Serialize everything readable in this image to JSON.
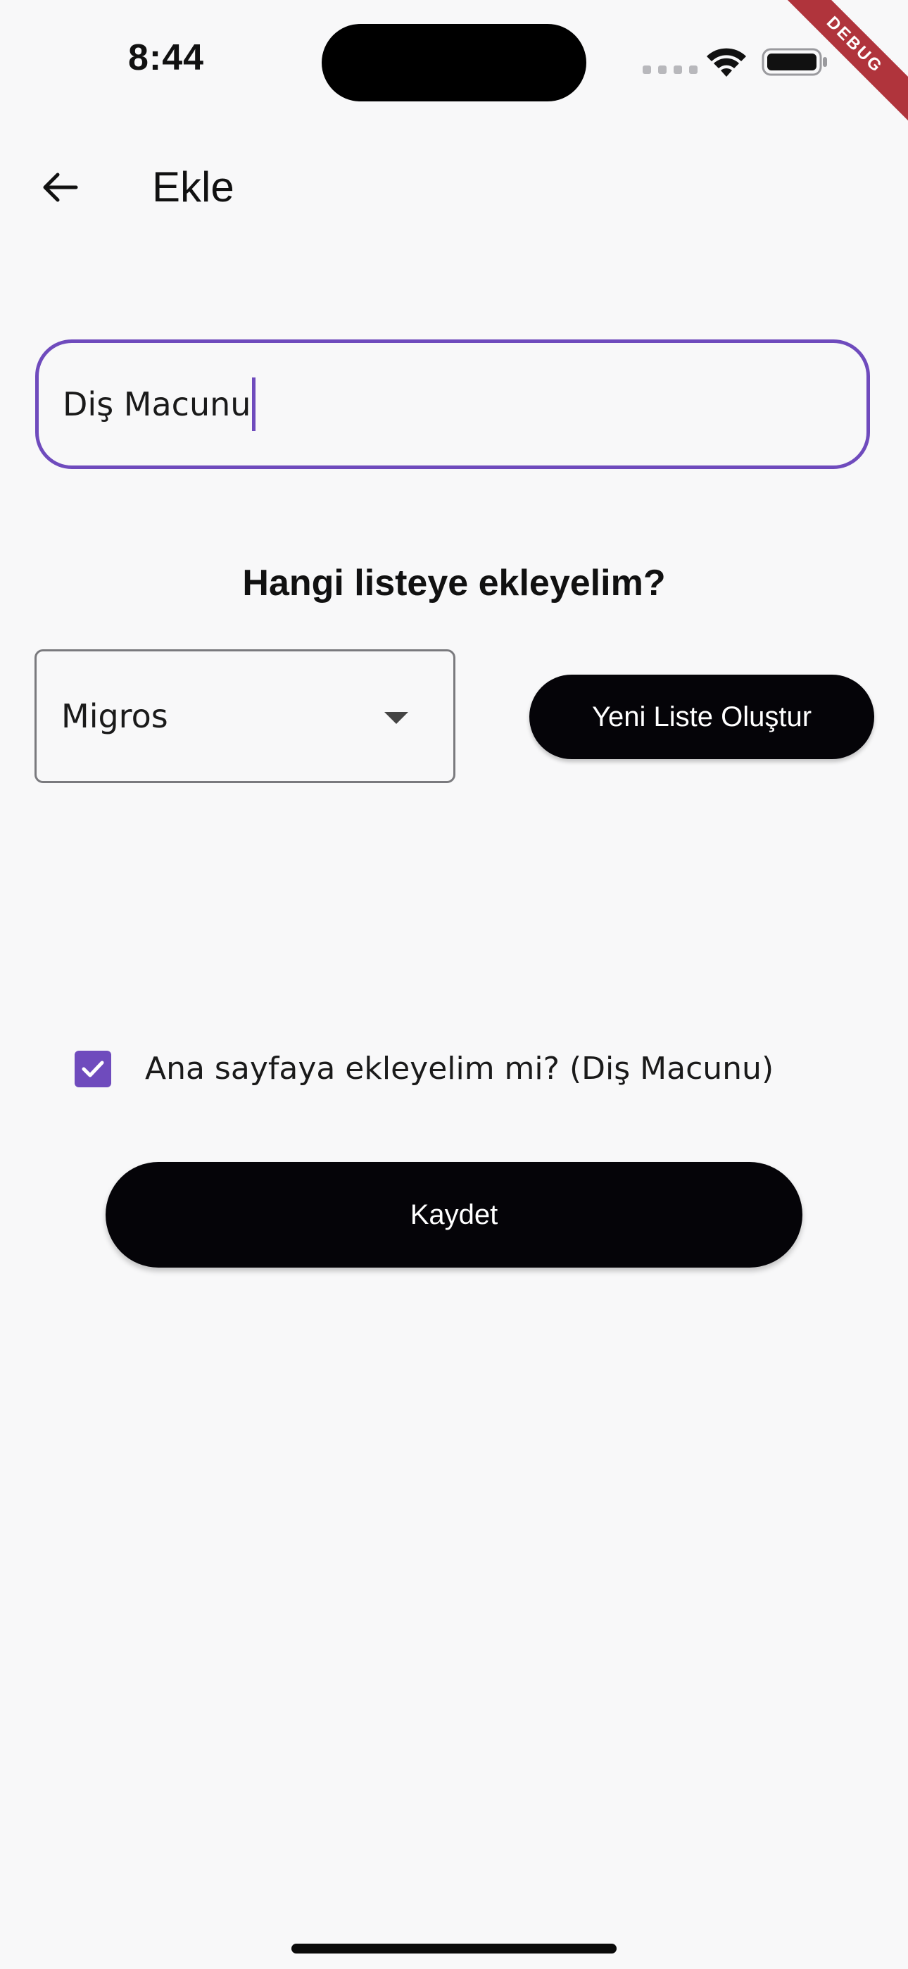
{
  "status_bar": {
    "time": "8:44",
    "icons": [
      "cellular-signal-icon",
      "wifi-icon",
      "battery-icon"
    ]
  },
  "debug_banner": {
    "label": "DEBUG",
    "color": "#b0343c"
  },
  "app_bar": {
    "back_icon": "arrow-left-icon",
    "title": "Ekle"
  },
  "item_name_field": {
    "value": "Diş Macunu",
    "focused": true,
    "focus_color": "#6f4bbd"
  },
  "list_section": {
    "heading": "Hangi listeye ekleyelim?",
    "dropdown": {
      "selected": "Migros",
      "icon": "caret-down-icon"
    },
    "new_list_button": "Yeni Liste Oluştur"
  },
  "home_option": {
    "checked": true,
    "label": "Ana sayfaya ekleyelim mi? (Diş Macunu)",
    "icon": "checkmark-icon",
    "color": "#6f4bbd"
  },
  "save_button": {
    "label": "Kaydet"
  },
  "colors": {
    "background": "#f8f8f9",
    "primary_button": "#050408",
    "accent": "#6f4bbd"
  }
}
